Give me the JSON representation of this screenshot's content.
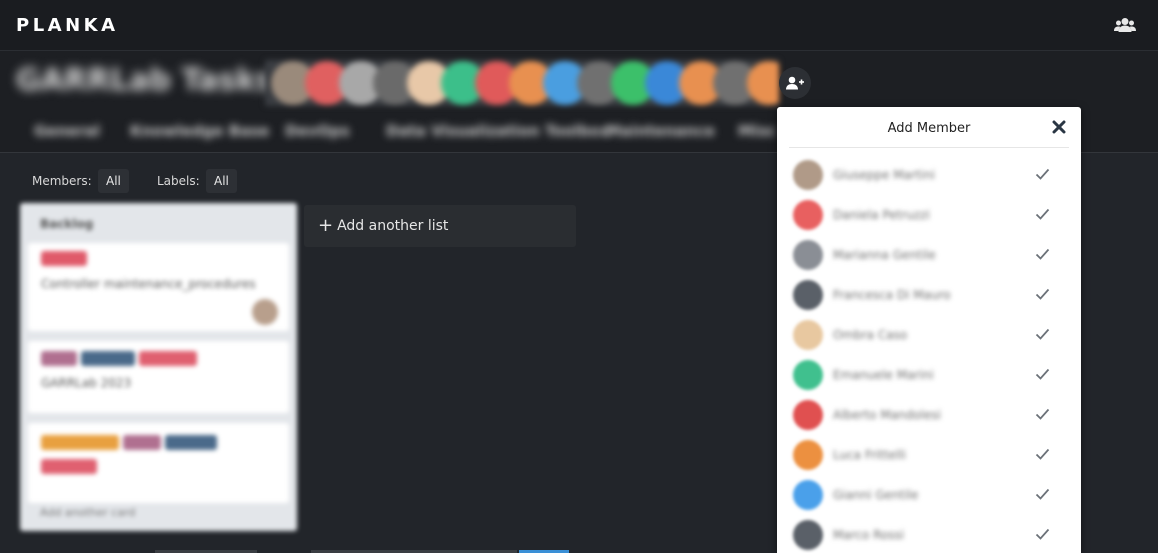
{
  "app": {
    "logo": "PLANKA",
    "icons": {
      "users": "users-icon",
      "add_member": "add-user-icon",
      "close": "close-icon",
      "check": "check-icon",
      "plus": "plus-icon"
    }
  },
  "board": {
    "project_title": "GARRLab Tasks",
    "avatar_colors": [
      "#9a8a7b",
      "#e06060",
      "#a8a8a8",
      "#6a6a6a",
      "#e8c8a8",
      "#3cbf8a",
      "#e05a5a",
      "#e89050",
      "#4a9ee0",
      "#707070",
      "#3cc06a",
      "#3a88d8",
      "#e89050",
      "#707070",
      "#e89050",
      "#3cbf8a"
    ],
    "tabs": [
      "General",
      "Knowledge Base",
      "DevOps",
      "Data Visualization Toolbox",
      "Maintenance",
      "Misc"
    ]
  },
  "filters": {
    "members_label": "Members:",
    "members_value": "All",
    "labels_label": "Labels:",
    "labels_value": "All"
  },
  "lists": [
    {
      "title": "Backlog",
      "cards": [
        {
          "text": "Controller maintenance_procedures",
          "labels": [
            "#e05a6a"
          ]
        },
        {
          "text": "GARRLab 2023",
          "labels": [
            "#b07090",
            "#4a6a8a",
            "#e06070"
          ]
        },
        {
          "text": "",
          "labels": [
            "#e8a040",
            "#b07090",
            "#4a6a8a",
            "#e06070"
          ]
        }
      ],
      "add_card": "Add another card"
    }
  ],
  "add_list": {
    "label": "Add another list"
  },
  "popup": {
    "title": "Add Member",
    "members": [
      {
        "name": "Giuseppe Martini",
        "color": "#b09a88"
      },
      {
        "name": "Daniela Petruzzi",
        "color": "#e86060"
      },
      {
        "name": "Marianna Gentile",
        "color": "#8a8e95"
      },
      {
        "name": "Francesca Di Mauro",
        "color": "#5a6068"
      },
      {
        "name": "Ombra Caso",
        "color": "#e8c8a0"
      },
      {
        "name": "Emanuele Marini",
        "color": "#40c08e"
      },
      {
        "name": "Alberto Mandolesi",
        "color": "#e05050"
      },
      {
        "name": "Luca Frittelli",
        "color": "#ec9040"
      },
      {
        "name": "Gianni Gentile",
        "color": "#4aa0ea"
      },
      {
        "name": "Marco Rossi",
        "color": "#5a6068"
      }
    ]
  }
}
